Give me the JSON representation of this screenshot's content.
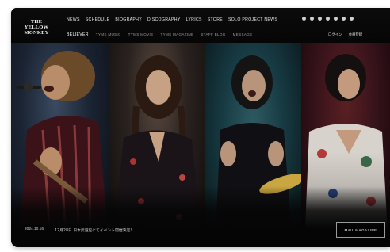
{
  "header": {
    "logo_text": "THE YELLOW MONKEY",
    "nav": [
      "NEWS",
      "SCHEDULE",
      "BIOGRAPHY",
      "DISCOGRAPHY",
      "LYRICS",
      "STORE",
      "SOLO PROJECT NEWS"
    ],
    "subnav_active": "BELIEVER",
    "subnav": [
      "TYMS MUSIC",
      "TYMS MOVIE",
      "TYMS MAGAZINE",
      "STAFF BLOG",
      "MESSAGE"
    ],
    "account": [
      "ログイン",
      "会員登録"
    ]
  },
  "social_icons": [
    "apple-icon",
    "twitter-icon",
    "facebook-icon",
    "instagram-icon",
    "tiktok-icon",
    "youtube-icon",
    "line-icon"
  ],
  "panels": [
    {
      "subject": "singer with microphone, curly hair, striped shirt"
    },
    {
      "subject": "guitarist with long hair, dark floral shirt"
    },
    {
      "subject": "drummer with long hair, cymbal"
    },
    {
      "subject": "bassist with curly hair, floral shirt"
    }
  ],
  "news": {
    "date": "2024.10.16",
    "text": "12月28日 日本武道館にてイベント開催決定!"
  },
  "mail_button": "MAIL MAGAZINE",
  "colors": {
    "background": "#050505",
    "nav_text": "#e8e8e8"
  }
}
